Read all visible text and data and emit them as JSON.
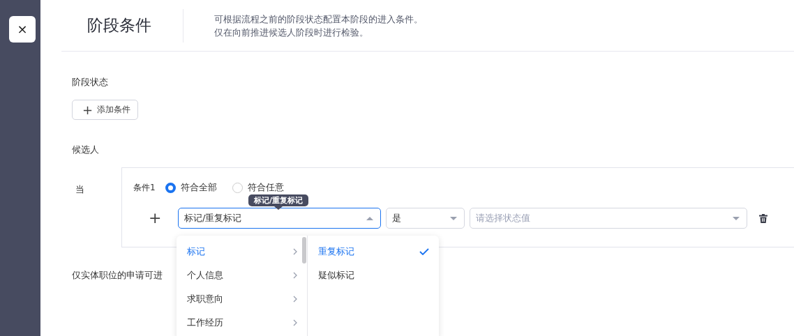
{
  "close_button": {
    "label": "×"
  },
  "header": {
    "title": "阶段条件",
    "description": [
      "可根据流程之前的阶段状态配置本阶段的进入条件。",
      "仅在向前推进候选人阶段时进行检验。"
    ]
  },
  "stage_status": {
    "label": "阶段状态",
    "add_button": {
      "icon": "+",
      "label": "添加条件"
    }
  },
  "candidate": {
    "label": "候选人",
    "when": "当",
    "condition": {
      "name": "条件1",
      "match_options": [
        {
          "label": "符合全部",
          "selected": true
        },
        {
          "label": "符合任意",
          "selected": false
        }
      ],
      "add_icon": "+",
      "field_select": {
        "value": "标记/重复标记",
        "expanded": true
      },
      "operator_select": {
        "value": "是",
        "expanded": false
      },
      "value_select": {
        "placeholder": "请选择状态值",
        "expanded": false
      },
      "tooltip": "标记/重复标记",
      "menu": {
        "categories": [
          {
            "label": "标记",
            "selected": true
          },
          {
            "label": "个人信息",
            "selected": false
          },
          {
            "label": "求职意向",
            "selected": false
          },
          {
            "label": "工作经历",
            "selected": false
          }
        ],
        "options": [
          {
            "label": "重复标记",
            "selected": true
          },
          {
            "label": "疑似标记",
            "selected": false
          }
        ]
      }
    }
  },
  "entity_note": "仅实体职位的申请可进"
}
